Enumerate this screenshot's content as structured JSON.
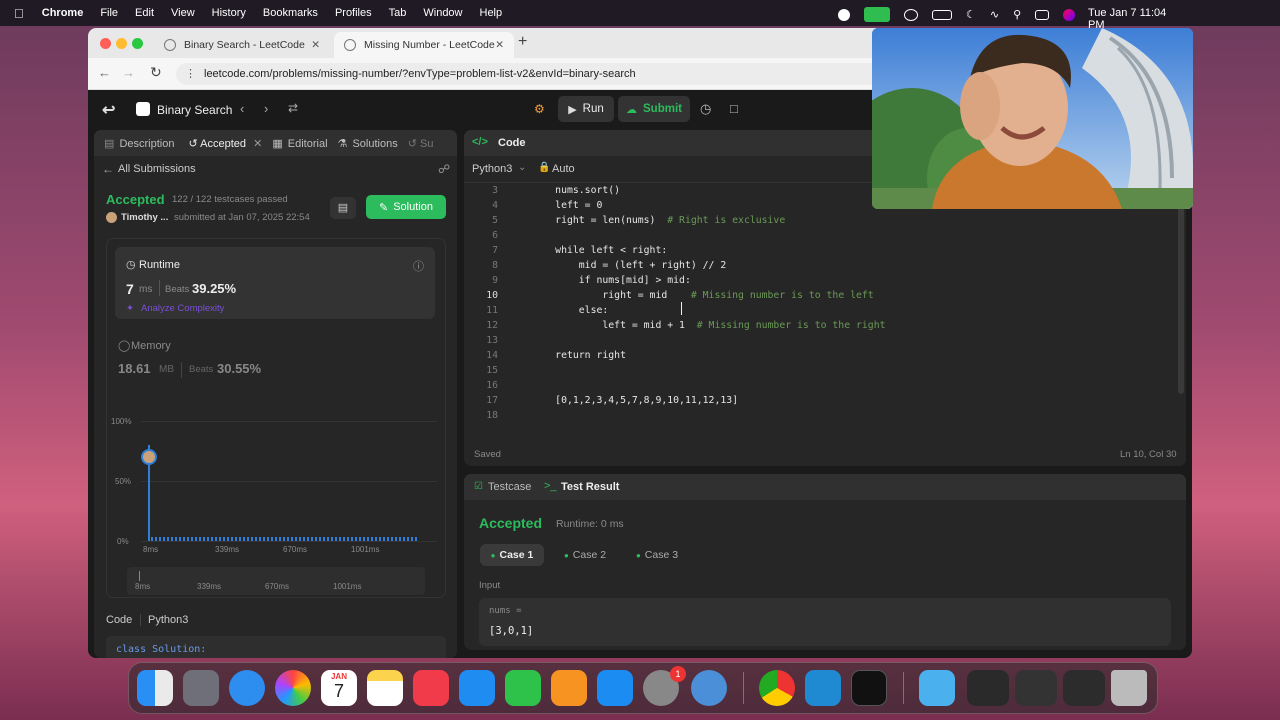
{
  "menubar": {
    "items": [
      "Chrome",
      "File",
      "Edit",
      "View",
      "History",
      "Bookmarks",
      "Profiles",
      "Tab",
      "Window",
      "Help"
    ],
    "clock": "Tue Jan 7  11:04 PM"
  },
  "browser": {
    "tabs": [
      {
        "title": "Binary Search - LeetCode",
        "active": false
      },
      {
        "title": "Missing Number - LeetCode",
        "active": true
      }
    ],
    "url": "leetcode.com/problems/missing-number/?envType=problem-list-v2&envId=binary-search"
  },
  "lcnav": {
    "problem_list": "Binary Search",
    "run": "Run",
    "submit": "Submit"
  },
  "left": {
    "tabs": [
      "Description",
      "Accepted",
      "Editorial",
      "Solutions",
      "Su"
    ],
    "all_submissions": "All Submissions",
    "status": "Accepted",
    "testcases": "122 / 122 testcases passed",
    "user": "Timothy ...",
    "submitted": "submitted at Jan 07, 2025 22:54",
    "solution_btn": "Solution",
    "runtime_label": "Runtime",
    "runtime_value": "7",
    "runtime_unit": "ms",
    "beats_label": "Beats",
    "runtime_beats": "39.25%",
    "analyze": "Analyze Complexity",
    "memory_label": "Memory",
    "memory_value": "18.61",
    "memory_unit": "MB",
    "memory_beats": "30.55%",
    "chart_y": [
      "100%",
      "50%",
      "0%"
    ],
    "chart_x": [
      "8ms",
      "339ms",
      "670ms",
      "1001ms"
    ],
    "code_label": "Code",
    "code_lang": "Python3",
    "code_preview": "class Solution:"
  },
  "code": {
    "tab": "Code",
    "lang": "Python3",
    "auto": "Auto",
    "saved": "Saved",
    "position": "Ln 10, Col 30",
    "lines": [
      {
        "n": "3",
        "code": "        nums.sort()",
        "comment": ""
      },
      {
        "n": "4",
        "code": "        left = 0",
        "comment": ""
      },
      {
        "n": "5",
        "code": "        right = len(nums)  ",
        "comment": "# Right is exclusive"
      },
      {
        "n": "6",
        "code": "",
        "comment": ""
      },
      {
        "n": "7",
        "code": "        while left < right:",
        "comment": ""
      },
      {
        "n": "8",
        "code": "            mid = (left + right) // 2",
        "comment": ""
      },
      {
        "n": "9",
        "code": "            if nums[mid] > mid:",
        "comment": ""
      },
      {
        "n": "10",
        "code": "                right = mid    ",
        "comment": "# Missing number is to the left"
      },
      {
        "n": "11",
        "code": "            else:",
        "comment": ""
      },
      {
        "n": "12",
        "code": "                left = mid + 1  ",
        "comment": "# Missing number is to the right"
      },
      {
        "n": "13",
        "code": "",
        "comment": ""
      },
      {
        "n": "14",
        "code": "        return right",
        "comment": ""
      },
      {
        "n": "15",
        "code": "",
        "comment": ""
      },
      {
        "n": "16",
        "code": "",
        "comment": ""
      },
      {
        "n": "17",
        "code": "        [0,1,2,3,4,5,7,8,9,10,11,12,13]",
        "comment": ""
      },
      {
        "n": "18",
        "code": "",
        "comment": ""
      }
    ]
  },
  "result": {
    "tabs": [
      "Testcase",
      "Test Result"
    ],
    "status": "Accepted",
    "runtime": "Runtime: 0 ms",
    "cases": [
      "Case 1",
      "Case 2",
      "Case 3"
    ],
    "input_label": "Input",
    "param": "nums =",
    "value": "[3,0,1]"
  },
  "dock": {
    "calendar_month": "JAN",
    "calendar_day": "7",
    "badge": "1"
  }
}
